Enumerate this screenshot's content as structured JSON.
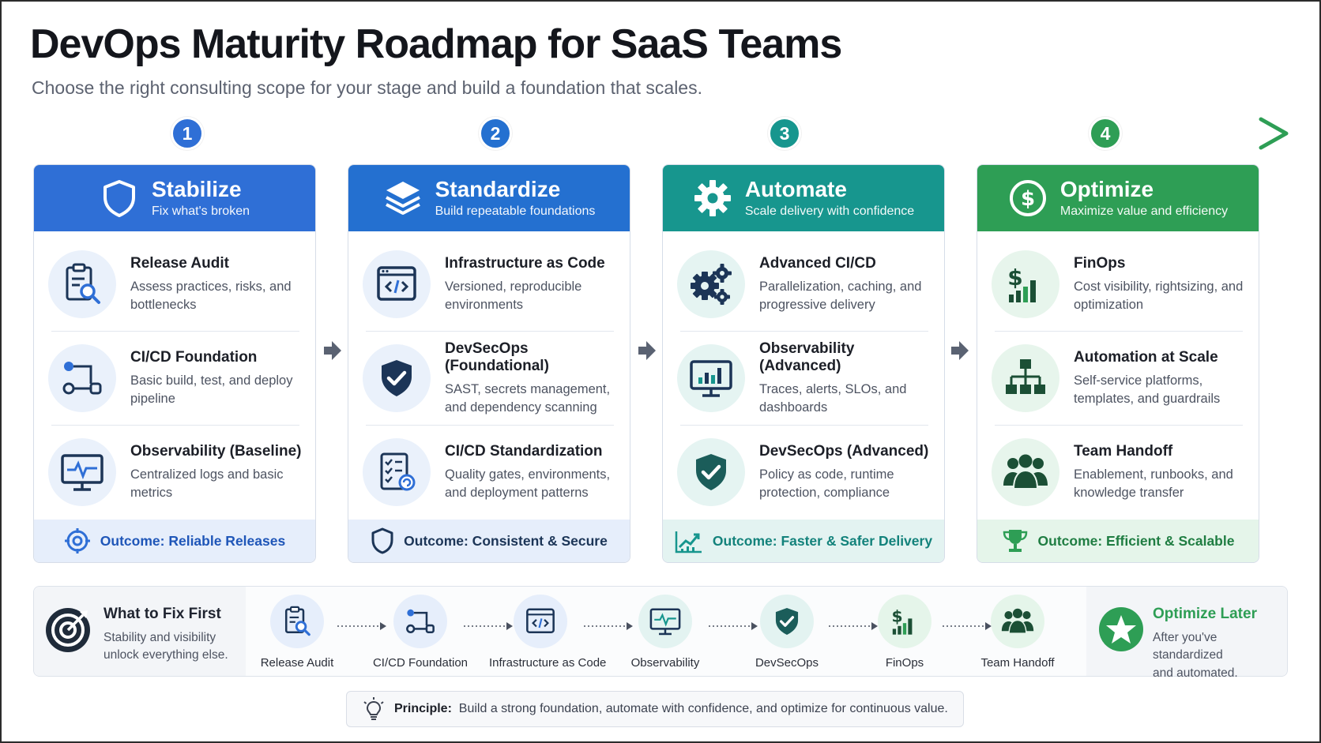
{
  "title": "DevOps Maturity Roadmap for SaaS Teams",
  "subtitle": "Choose the right consulting scope for your stage and build a foundation that scales.",
  "colors": {
    "blue": "#2f6fd6",
    "teal": "#17968e",
    "green": "#2e9e55",
    "navy": "#1c3557"
  },
  "timeline": [
    "1",
    "2",
    "3",
    "4"
  ],
  "stages": [
    {
      "title": "Stabilize",
      "subtitle": "Fix what's broken",
      "icon": "shield-icon",
      "items": [
        {
          "title": "Release Audit",
          "desc": "Assess practices, risks, and bottlenecks",
          "icon": "clipboard-search-icon"
        },
        {
          "title": "CI/CD Foundation",
          "desc": "Basic build, test, and deploy pipeline",
          "icon": "pipeline-icon"
        },
        {
          "title": "Observability (Baseline)",
          "desc": "Centralized logs and basic metrics",
          "icon": "monitor-pulse-icon"
        }
      ],
      "outcome": "Outcome: Reliable Releases",
      "outcome_icon": "target-icon"
    },
    {
      "title": "Standardize",
      "subtitle": "Build repeatable foundations",
      "icon": "layers-icon",
      "items": [
        {
          "title": "Infrastructure as Code",
          "desc": "Versioned, reproducible environments",
          "icon": "code-window-icon"
        },
        {
          "title": "DevSecOps (Foundational)",
          "desc": "SAST, secrets management, and dependency scanning",
          "icon": "shield-check-icon"
        },
        {
          "title": "CI/CD Standardization",
          "desc": "Quality gates, environments, and deployment patterns",
          "icon": "checklist-icon"
        }
      ],
      "outcome": "Outcome: Consistent & Secure",
      "outcome_icon": "shield-outline-icon"
    },
    {
      "title": "Automate",
      "subtitle": "Scale delivery with confidence",
      "icon": "gear-icon",
      "items": [
        {
          "title": "Advanced CI/CD",
          "desc": "Parallelization, caching, and progressive delivery",
          "icon": "gears-icon"
        },
        {
          "title": "Observability (Advanced)",
          "desc": "Traces, alerts, SLOs, and dashboards",
          "icon": "monitor-chart-icon"
        },
        {
          "title": "DevSecOps (Advanced)",
          "desc": "Policy as code, runtime protection, compliance",
          "icon": "shield-check-icon"
        }
      ],
      "outcome": "Outcome: Faster & Safer Delivery",
      "outcome_icon": "trend-chart-icon"
    },
    {
      "title": "Optimize",
      "subtitle": "Maximize value and efficiency",
      "icon": "dollar-circle-icon",
      "items": [
        {
          "title": "FinOps",
          "desc": "Cost visibility, rightsizing, and optimization",
          "icon": "dollar-bars-icon"
        },
        {
          "title": "Automation at Scale",
          "desc": "Self-service platforms, templates, and guardrails",
          "icon": "hierarchy-icon"
        },
        {
          "title": "Team Handoff",
          "desc": "Enablement, runbooks, and knowledge transfer",
          "icon": "team-icon"
        }
      ],
      "outcome": "Outcome: Efficient & Scalable",
      "outcome_icon": "trophy-icon"
    }
  ],
  "path": {
    "left_title": "What to Fix First",
    "left_desc_1": "Stability and visibility",
    "left_desc_2": "unlock everything else.",
    "steps": [
      {
        "label": "Release Audit",
        "icon": "clipboard-search-icon"
      },
      {
        "label": "CI/CD Foundation",
        "icon": "pipeline-icon"
      },
      {
        "label": "Infrastructure as Code",
        "icon": "code-window-icon"
      },
      {
        "label": "Observability",
        "icon": "monitor-pulse-icon"
      },
      {
        "label": "DevSecOps",
        "icon": "shield-check-icon"
      },
      {
        "label": "FinOps",
        "icon": "dollar-bars-icon"
      },
      {
        "label": "Team Handoff",
        "icon": "team-icon"
      }
    ],
    "right_title": "Optimize Later",
    "right_desc_1": "After you've standardized",
    "right_desc_2": "and automated."
  },
  "principle": {
    "label": "Principle:",
    "text": "Build a strong foundation, automate with confidence, and optimize for continuous value."
  }
}
